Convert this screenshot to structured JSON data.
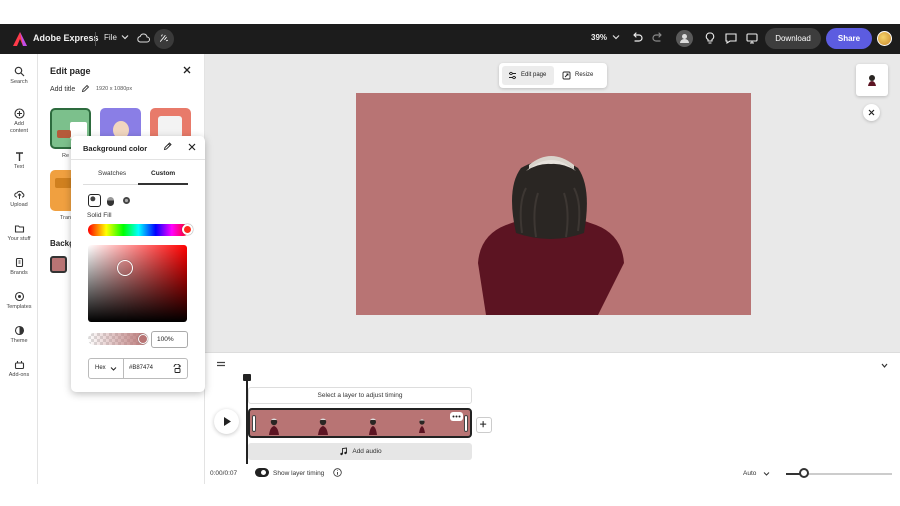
{
  "header": {
    "app_name": "Adobe Express",
    "file_label": "File",
    "zoom": "39%",
    "download_label": "Download",
    "share_label": "Share"
  },
  "rail": {
    "items": [
      {
        "label": "Search",
        "icon": "search-icon"
      },
      {
        "label": "Add content",
        "icon": "add-content-icon"
      },
      {
        "label": "Text",
        "icon": "text-icon"
      },
      {
        "label": "Upload",
        "icon": "upload-icon"
      },
      {
        "label": "Your stuff",
        "icon": "folder-icon"
      },
      {
        "label": "Brands",
        "icon": "brands-icon"
      },
      {
        "label": "Templates",
        "icon": "templates-icon"
      },
      {
        "label": "Theme",
        "icon": "theme-icon"
      },
      {
        "label": "Add-ons",
        "icon": "add-ons-icon"
      }
    ]
  },
  "edit_panel": {
    "title": "Edit page",
    "add_title": "Add title",
    "size": "1920 x 1080px",
    "template_label_1": "Re",
    "template_label_2": "Tran",
    "background_heading": "Backg",
    "background_color": "#B87474"
  },
  "color_popover": {
    "title": "Background color",
    "tabs": [
      "Swatches",
      "Custom"
    ],
    "active_tab": "Custom",
    "fill_label": "Solid Fill",
    "opacity": "100%",
    "format": "Hex",
    "hex_value": "#B87474"
  },
  "canvas": {
    "toolbar": {
      "edit_page": "Edit page",
      "resize": "Resize"
    },
    "background": "#B87474"
  },
  "timeline": {
    "layer_hint": "Select a layer to adjust timing",
    "add_audio": "Add audio",
    "time": "0:00/0:07",
    "show_timing_label": "Show layer timing",
    "show_timing_on": true,
    "auto_label": "Auto"
  },
  "colors": {
    "topbar": "#1c1c1c",
    "accent": "#5c5ce0",
    "page_bg": "#B87474"
  }
}
